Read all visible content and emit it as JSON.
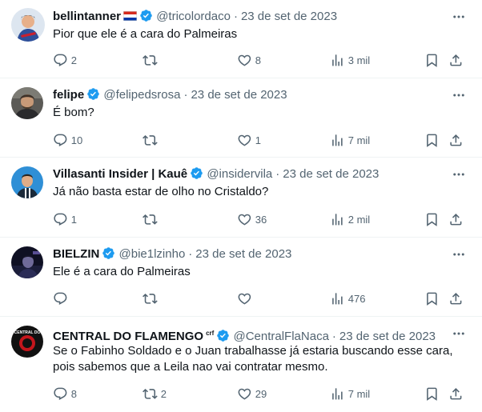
{
  "tweets": [
    {
      "name": "bellintanner",
      "has_flag": true,
      "handle": "@tricolordaco",
      "date": "23 de set de 2023",
      "text": "Pior que ele é a cara do Palmeiras",
      "replies": "2",
      "retweets": "",
      "likes": "8",
      "views": "3 mil"
    },
    {
      "name": "felipe",
      "handle": "@felipedsrosa",
      "date": "23 de set de 2023",
      "text": "É bom?",
      "replies": "10",
      "retweets": "",
      "likes": "1",
      "views": "7 mil"
    },
    {
      "name": "Villasanti Insider | Kauê",
      "handle": "@insidervila",
      "date": "23 de set de 2023",
      "text": "Já não basta estar de olho no Cristaldo?",
      "replies": "1",
      "retweets": "",
      "likes": "36",
      "views": "2 mil"
    },
    {
      "name": "BIELZIN",
      "handle": "@bie1lzinho",
      "date": "23 de set de 2023",
      "text": "Ele é a cara do Palmeiras",
      "replies": "",
      "retweets": "",
      "likes": "",
      "views": "476"
    },
    {
      "name": "CENTRAL DO FLAMENGO",
      "name_suffix": "crf",
      "handle": "@CentralFlaNaca",
      "date": "23 de set de 2023",
      "text": "Se o Fabinho Soldado e o Juan trabalhasse já estaria buscando esse cara, pois sabemos que a Leila nao vai contratar mesmo.",
      "avatar_text": "CENTRAL DO",
      "replies": "8",
      "retweets": "2",
      "likes": "29",
      "views": "7 mil"
    }
  ],
  "colors": {
    "verified": "#1d9bf0",
    "text_primary": "#0f1419",
    "text_secondary": "#536471",
    "divider": "#eff3f4"
  },
  "icons": [
    "more-icon",
    "verified-icon",
    "reply-icon",
    "retweet-icon",
    "like-icon",
    "views-icon",
    "bookmark-icon",
    "share-icon"
  ]
}
